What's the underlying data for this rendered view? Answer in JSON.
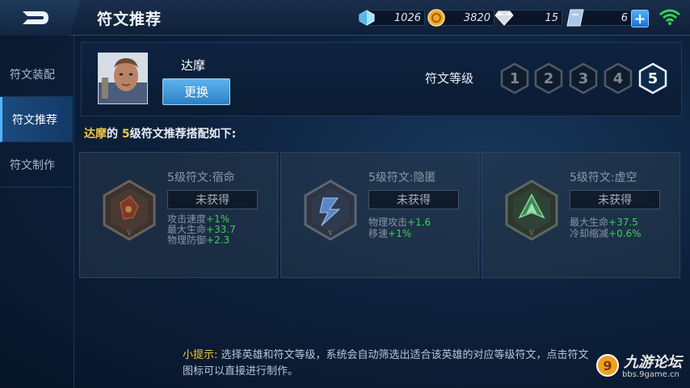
{
  "header": {
    "title": "符文推荐",
    "back_label": "",
    "resources": [
      {
        "icon": "crystal-icon",
        "value": "1026"
      },
      {
        "icon": "gold-coin-icon",
        "value": "3820"
      },
      {
        "icon": "diamond-icon",
        "value": "15"
      },
      {
        "icon": "voucher-icon",
        "value": "6"
      }
    ],
    "plus_label": "+"
  },
  "sidebar": {
    "items": [
      {
        "label": "符文装配",
        "active": false
      },
      {
        "label": "符文推荐",
        "active": true
      },
      {
        "label": "符文制作",
        "active": false
      }
    ]
  },
  "hero": {
    "name": "达摩",
    "change_label": "更换"
  },
  "level": {
    "label": "符文等级",
    "options": [
      "1",
      "2",
      "3",
      "4",
      "5"
    ],
    "selected": "5"
  },
  "recommend": {
    "hero": "达摩",
    "middle": "的",
    "level": "5",
    "suffix": "级符文推荐搭配如下:"
  },
  "cards": [
    {
      "name": "5级符文:宿命",
      "status": "未获得",
      "color": "#b04a2a",
      "attrs": [
        {
          "label": "攻击速度",
          "value": "+1%"
        },
        {
          "label": "最大生命",
          "value": "+33.7"
        },
        {
          "label": "物理防御",
          "value": "+2.3"
        }
      ]
    },
    {
      "name": "5级符文:隐匿",
      "status": "未获得",
      "color": "#2f63b8",
      "attrs": [
        {
          "label": "物理攻击",
          "value": "+1.6"
        },
        {
          "label": "移速",
          "value": "+1%"
        }
      ]
    },
    {
      "name": "5级符文:虚空",
      "status": "未获得",
      "color": "#2e8a4a",
      "attrs": [
        {
          "label": "最大生命",
          "value": "+37.5"
        },
        {
          "label": "冷却缩减",
          "value": "+0.6%"
        }
      ]
    }
  ],
  "tip": {
    "label": "小提示:",
    "text": "选择英雄和符文等级，系统会自动筛选出适合该英雄的对应等级符文，点击符文图标可以直接进行制作。"
  },
  "watermark": {
    "name": "九游论坛",
    "url": "bbs.9game.cn"
  }
}
